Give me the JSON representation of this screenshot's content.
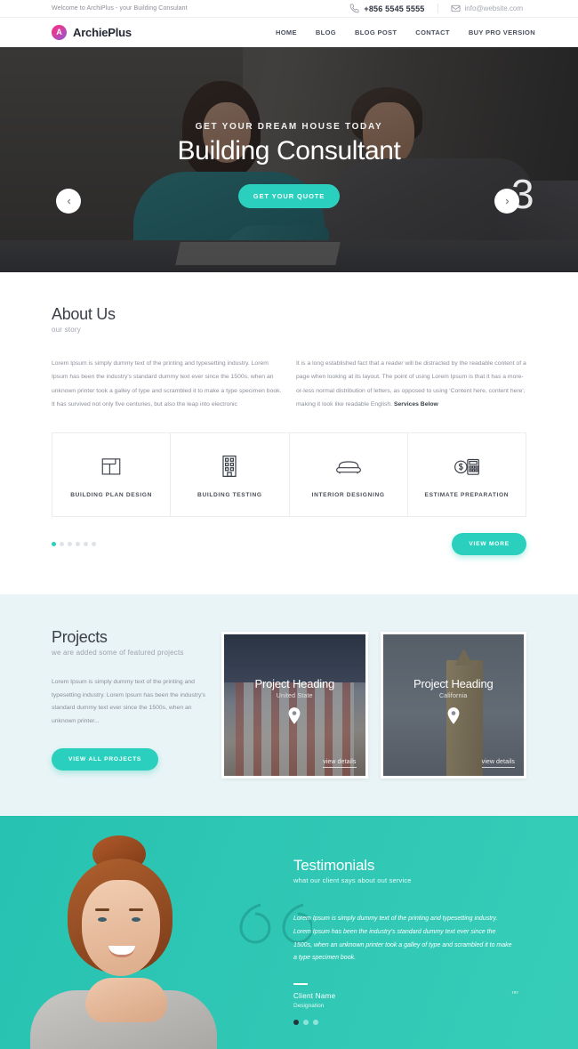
{
  "topbar": {
    "welcome": "Welcome to ArchiPlus - your Building Consulant",
    "phone": "+856 5545 5555",
    "email": "info@website.com",
    "phone_icon": "phone-icon",
    "mail_icon": "mail-icon"
  },
  "header": {
    "logo_letter": "A",
    "brand": "ArchiePlus",
    "nav": [
      {
        "label": "HOME"
      },
      {
        "label": "BLOG"
      },
      {
        "label": "BLOG POST"
      },
      {
        "label": "CONTACT"
      },
      {
        "label": "BUY PRO VERSION"
      }
    ]
  },
  "hero": {
    "kicker": "GET YOUR DREAM HOUSE TODAY",
    "title": "Building Consultant",
    "cta": "GET YOUR QUOTE",
    "slide_count": "3",
    "prev_icon": "chevron-left-icon",
    "next_icon": "chevron-right-icon"
  },
  "about": {
    "title": "About Us",
    "subtitle": "our story",
    "paragraph_left": "Lorem Ipsum is simply dummy text of the printing and typesetting industry. Lorem Ipsum has been the industry's standard dummy text ever since the 1500s, when an unknown printer took a galley of type and scrambled it to make a type specimen book. It has survived not only five centuries, but also the leap into electronic",
    "paragraph_right": "It is a long established fact that a reader will be distracted by the readable content of a page when looking at its layout. The point of using Lorem Ipsum is that it has a more-or-less normal distribution of letters, as opposed to using 'Content here, content here', making it look like readable English. ",
    "paragraph_right_bold": "Services Below",
    "services": [
      {
        "label": "BUILDING PLAN DESIGN",
        "icon": "floor-plan-icon"
      },
      {
        "label": "BUILDING TESTING",
        "icon": "building-icon"
      },
      {
        "label": "INTERIOR DESIGNING",
        "icon": "sofa-icon"
      },
      {
        "label": "ESTIMATE PREPARATION",
        "icon": "calculator-icon"
      }
    ],
    "dots": [
      true,
      false,
      false,
      false,
      false,
      false
    ],
    "view_more": "VIEW MORE"
  },
  "projects": {
    "title": "Projects",
    "subtitle": "we are added some of featured projects",
    "paragraph": "Lorem Ipsum is simply dummy text of the printing and typesetting industry. Lorem Ipsum has been the industry's standard dummy text ever since the 1500s, when an unknown printer...",
    "cta": "VIEW ALL PROJECTS",
    "cards": [
      {
        "title": "Project Heading",
        "location": "United State",
        "link": "view details",
        "pin_icon": "map-pin-icon"
      },
      {
        "title": "Project Heading",
        "location": "California",
        "link": "view details",
        "pin_icon": "map-pin-icon"
      }
    ]
  },
  "testimonials": {
    "title": "Testimonials",
    "subtitle": "what our client says about out service",
    "quote": "Lorem Ipsum is simply dummy text of the printing and typesetting industry. Lorem Ipsum has been the industry's standard dummy text ever since the 1500s, when an unknown printer took a galley of type and scrambled it to make a type specimen book.",
    "end_quote": "””",
    "client_name": "Client Name",
    "designation": "Designation",
    "dots": [
      true,
      false,
      false
    ],
    "quote_icon": "quote-mark-icon"
  },
  "colors": {
    "accent": "#2ad0bd",
    "teal_bg": "#2ec6b4",
    "projects_bg": "#e9f4f6",
    "brand_pink": "#f02a8e",
    "brand_purple": "#8b5ad6"
  }
}
